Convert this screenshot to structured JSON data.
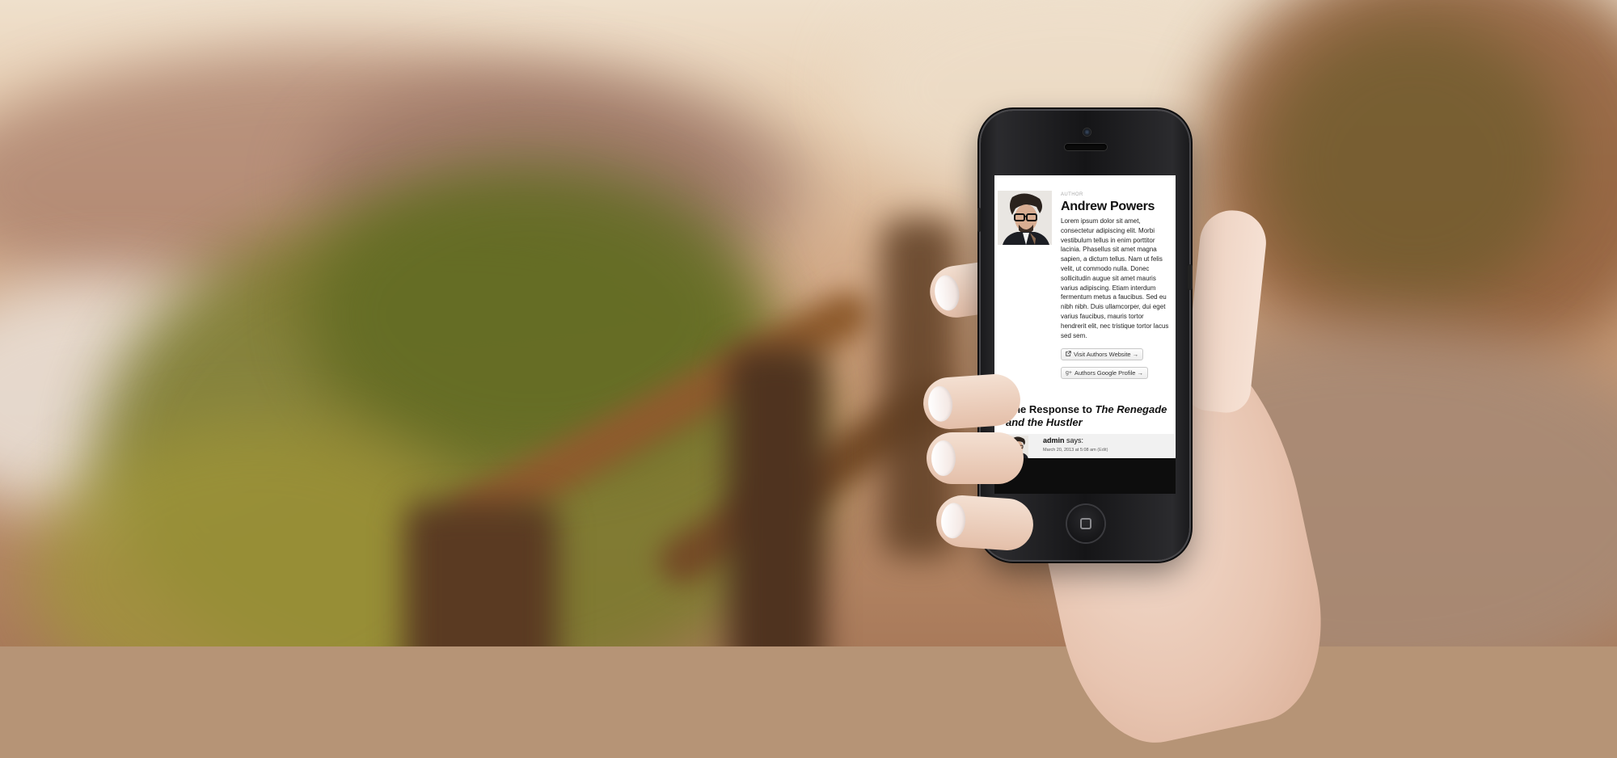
{
  "author_section": {
    "label": "AUTHOR",
    "name": "Andrew Powers",
    "bio": "Lorem ipsum dolor sit amet, consectetur adipiscing elit. Morbi vestibulum tellus in enim porttitor lacinia. Phasellus sit amet magna sapien, a dictum tellus. Nam ut felis velit, ut commodo nulla. Donec sollicitudin augue sit amet mauris varius adipiscing. Etiam interdum fermentum metus a faucibus. Sed eu nibh nibh. Duis ullamcorper, dui eget varius faucibus, mauris tortor hendrerit elit, nec tristique tortor lacus sed sem.",
    "website_button": "Visit Authors Website →",
    "website_icon": "external-link-icon",
    "google_button": "Authors Google Profile →",
    "google_icon": "google-plus-icon"
  },
  "comments": {
    "title_prefix": "One Response to ",
    "title_post": "The Renegade and the Hustler",
    "items": [
      {
        "author": "admin",
        "says": " says:",
        "date": "March 20, 2013 at 5:08 am",
        "edit": "(Edit)"
      }
    ]
  },
  "colors": {
    "phone_body": "#151517",
    "page_background": "#ffffff",
    "comment_background": "#f1f1f1"
  }
}
